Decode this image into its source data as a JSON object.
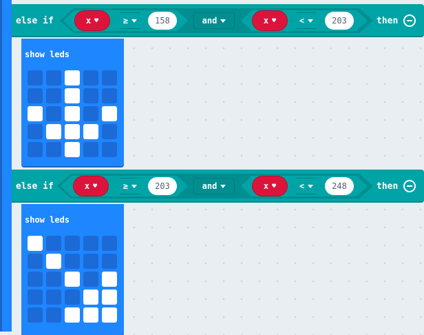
{
  "blocks": [
    {
      "keyword": "else if",
      "left": {
        "var": "x",
        "op": "≥",
        "value": "158"
      },
      "logic": "and",
      "right": {
        "var": "x",
        "op": "<",
        "value": "203"
      },
      "then_label": "then",
      "action_title": "show leds",
      "leds": [
        [
          0,
          0,
          1,
          0,
          0
        ],
        [
          0,
          0,
          1,
          0,
          0
        ],
        [
          1,
          0,
          1,
          0,
          1
        ],
        [
          0,
          1,
          1,
          1,
          0
        ],
        [
          0,
          0,
          1,
          0,
          0
        ]
      ]
    },
    {
      "keyword": "else if",
      "left": {
        "var": "x",
        "op": "≥",
        "value": "203"
      },
      "logic": "and",
      "right": {
        "var": "x",
        "op": "<",
        "value": "248"
      },
      "then_label": "then",
      "action_title": "show leds",
      "leds": [
        [
          1,
          0,
          0,
          0,
          0
        ],
        [
          0,
          1,
          0,
          0,
          0
        ],
        [
          0,
          0,
          1,
          0,
          1
        ],
        [
          0,
          0,
          0,
          1,
          1
        ],
        [
          0,
          0,
          1,
          1,
          1
        ]
      ]
    }
  ],
  "colors": {
    "logic_block": "#00a4a6",
    "variable": "#dc143c",
    "basic_block": "#1e86ff",
    "led_on": "#ffffff",
    "led_off": "#1c6ad6"
  },
  "icons": {
    "remove": "minus-circle-icon",
    "dropdown": "chevron-down-icon",
    "variable_dropdown": "heart-icon"
  }
}
